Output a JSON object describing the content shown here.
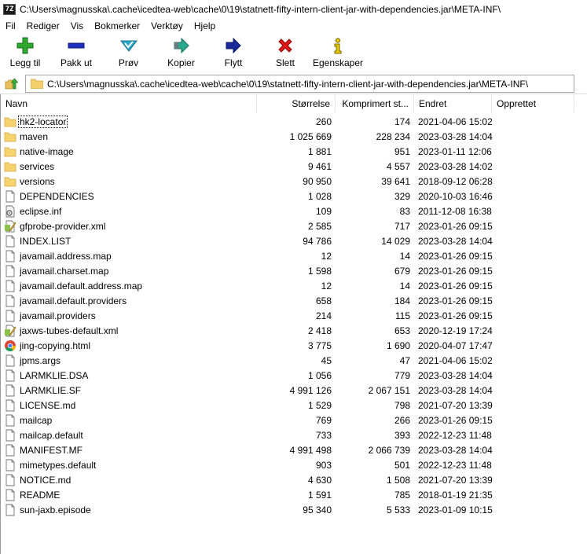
{
  "window": {
    "icon_text": "7Z",
    "title": "C:\\Users\\magnusska\\.cache\\icedtea-web\\cache\\0\\19\\statnett-fifty-intern-client-jar-with-dependencies.jar\\META-INF\\"
  },
  "menu": [
    "Fil",
    "Rediger",
    "Vis",
    "Bokmerker",
    "Verktøy",
    "Hjelp"
  ],
  "toolbar": [
    {
      "label": "Legg til",
      "icon": "add-icon",
      "color": "#2fa82f"
    },
    {
      "label": "Pakk ut",
      "icon": "extract-icon",
      "color": "#1f2fbf"
    },
    {
      "label": "Prøv",
      "icon": "test-icon",
      "color": "#2aa8c8"
    },
    {
      "label": "Kopier",
      "icon": "copy-icon",
      "color": "#2aa890"
    },
    {
      "label": "Flytt",
      "icon": "move-icon",
      "color": "#1a2a9a"
    },
    {
      "label": "Slett",
      "icon": "delete-icon",
      "color": "#e01818"
    },
    {
      "label": "Egenskaper",
      "icon": "info-icon",
      "color": "#e8c800"
    }
  ],
  "address": {
    "path": "C:\\Users\\magnusska\\.cache\\icedtea-web\\cache\\0\\19\\statnett-fifty-intern-client-jar-with-dependencies.jar\\META-INF\\"
  },
  "columns": {
    "name": "Navn",
    "size": "Størrelse",
    "compressed": "Komprimert st...",
    "modified": "Endret",
    "created": "Opprettet"
  },
  "files": [
    {
      "name": "hk2-locator",
      "size": "260",
      "compressed": "174",
      "modified": "2021-04-06 15:02",
      "icon": "folder-icon"
    },
    {
      "name": "maven",
      "size": "1 025 669",
      "compressed": "228 234",
      "modified": "2023-03-28 14:04",
      "icon": "folder-icon"
    },
    {
      "name": "native-image",
      "size": "1 881",
      "compressed": "951",
      "modified": "2023-01-11 12:06",
      "icon": "folder-icon"
    },
    {
      "name": "services",
      "size": "9 461",
      "compressed": "4 557",
      "modified": "2023-03-28 14:02",
      "icon": "folder-icon"
    },
    {
      "name": "versions",
      "size": "90 950",
      "compressed": "39 641",
      "modified": "2018-09-12 06:28",
      "icon": "folder-icon"
    },
    {
      "name": "DEPENDENCIES",
      "size": "1 028",
      "compressed": "329",
      "modified": "2020-10-03 16:46",
      "icon": "file-icon"
    },
    {
      "name": "eclipse.inf",
      "size": "109",
      "compressed": "83",
      "modified": "2011-12-08 16:38",
      "icon": "settings-file-icon"
    },
    {
      "name": "gfprobe-provider.xml",
      "size": "2 585",
      "compressed": "717",
      "modified": "2023-01-26 09:15",
      "icon": "xml-file-icon"
    },
    {
      "name": "INDEX.LIST",
      "size": "94 786",
      "compressed": "14 029",
      "modified": "2023-03-28 14:04",
      "icon": "file-icon"
    },
    {
      "name": "javamail.address.map",
      "size": "12",
      "compressed": "14",
      "modified": "2023-01-26 09:15",
      "icon": "file-icon"
    },
    {
      "name": "javamail.charset.map",
      "size": "1 598",
      "compressed": "679",
      "modified": "2023-01-26 09:15",
      "icon": "file-icon"
    },
    {
      "name": "javamail.default.address.map",
      "size": "12",
      "compressed": "14",
      "modified": "2023-01-26 09:15",
      "icon": "file-icon"
    },
    {
      "name": "javamail.default.providers",
      "size": "658",
      "compressed": "184",
      "modified": "2023-01-26 09:15",
      "icon": "file-icon"
    },
    {
      "name": "javamail.providers",
      "size": "214",
      "compressed": "115",
      "modified": "2023-01-26 09:15",
      "icon": "file-icon"
    },
    {
      "name": "jaxws-tubes-default.xml",
      "size": "2 418",
      "compressed": "653",
      "modified": "2020-12-19 17:24",
      "icon": "xml-file-icon"
    },
    {
      "name": "jing-copying.html",
      "size": "3 775",
      "compressed": "1 690",
      "modified": "2020-04-07 17:47",
      "icon": "chrome-icon"
    },
    {
      "name": "jpms.args",
      "size": "45",
      "compressed": "47",
      "modified": "2021-04-06 15:02",
      "icon": "file-icon"
    },
    {
      "name": "LARMKLIE.DSA",
      "size": "1 056",
      "compressed": "779",
      "modified": "2023-03-28 14:04",
      "icon": "file-icon"
    },
    {
      "name": "LARMKLIE.SF",
      "size": "4 991 126",
      "compressed": "2 067 151",
      "modified": "2023-03-28 14:04",
      "icon": "file-icon"
    },
    {
      "name": "LICENSE.md",
      "size": "1 529",
      "compressed": "798",
      "modified": "2021-07-20 13:39",
      "icon": "file-icon"
    },
    {
      "name": "mailcap",
      "size": "769",
      "compressed": "266",
      "modified": "2023-01-26 09:15",
      "icon": "file-icon"
    },
    {
      "name": "mailcap.default",
      "size": "733",
      "compressed": "393",
      "modified": "2022-12-23 11:48",
      "icon": "file-icon"
    },
    {
      "name": "MANIFEST.MF",
      "size": "4 991 498",
      "compressed": "2 066 739",
      "modified": "2023-03-28 14:04",
      "icon": "file-icon"
    },
    {
      "name": "mimetypes.default",
      "size": "903",
      "compressed": "501",
      "modified": "2022-12-23 11:48",
      "icon": "file-icon"
    },
    {
      "name": "NOTICE.md",
      "size": "4 630",
      "compressed": "1 508",
      "modified": "2021-07-20 13:39",
      "icon": "file-icon"
    },
    {
      "name": "README",
      "size": "1 591",
      "compressed": "785",
      "modified": "2018-01-19 21:35",
      "icon": "file-icon"
    },
    {
      "name": "sun-jaxb.episode",
      "size": "95 340",
      "compressed": "5 533",
      "modified": "2023-01-09 10:15",
      "icon": "file-icon"
    }
  ]
}
